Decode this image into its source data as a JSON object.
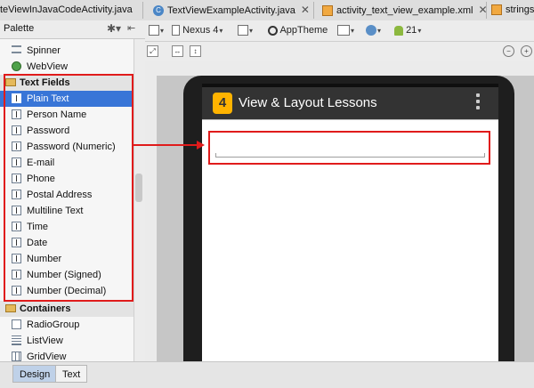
{
  "editor_tabs": [
    {
      "label": "teViewInJavaCodeActivity.java",
      "icon": "java-class-icon"
    },
    {
      "label": "TextViewExampleActivity.java",
      "icon": "java-class-icon"
    },
    {
      "label": "activity_text_view_example.xml",
      "icon": "xml-file-icon"
    },
    {
      "label": "strings",
      "icon": "xml-file-icon"
    }
  ],
  "palette": {
    "title": "Palette",
    "items": [
      {
        "label": "Spinner",
        "icon": "spinner-icon"
      },
      {
        "label": "WebView",
        "icon": "webview-icon"
      },
      {
        "label": "Text Fields",
        "icon": "folder-icon",
        "group": true
      },
      {
        "label": "Plain Text",
        "icon": "text-field-icon",
        "selected": true
      },
      {
        "label": "Person Name",
        "icon": "text-field-icon"
      },
      {
        "label": "Password",
        "icon": "text-field-icon"
      },
      {
        "label": "Password (Numeric)",
        "icon": "text-field-icon"
      },
      {
        "label": "E-mail",
        "icon": "text-field-icon"
      },
      {
        "label": "Phone",
        "icon": "text-field-icon"
      },
      {
        "label": "Postal Address",
        "icon": "text-field-icon"
      },
      {
        "label": "Multiline Text",
        "icon": "text-field-icon"
      },
      {
        "label": "Time",
        "icon": "text-field-icon"
      },
      {
        "label": "Date",
        "icon": "text-field-icon"
      },
      {
        "label": "Number",
        "icon": "text-field-icon"
      },
      {
        "label": "Number (Signed)",
        "icon": "text-field-icon"
      },
      {
        "label": "Number (Decimal)",
        "icon": "text-field-icon"
      },
      {
        "label": "Containers",
        "icon": "folder-icon",
        "group": true
      },
      {
        "label": "RadioGroup",
        "icon": "radiogroup-icon"
      },
      {
        "label": "ListView",
        "icon": "listview-icon"
      },
      {
        "label": "GridView",
        "icon": "gridview-icon"
      }
    ]
  },
  "toolbar": {
    "device": "Nexus 4",
    "theme": "AppTheme",
    "api_level": "21"
  },
  "preview": {
    "app_icon_text": "4",
    "app_title": "View & Layout Lessons"
  },
  "bottom_tabs": {
    "design": "Design",
    "text": "Text"
  },
  "colors": {
    "highlight": "#e01b1b",
    "selection": "#3875d7",
    "action_bar": "#333333",
    "app_icon": "#ffb300"
  }
}
